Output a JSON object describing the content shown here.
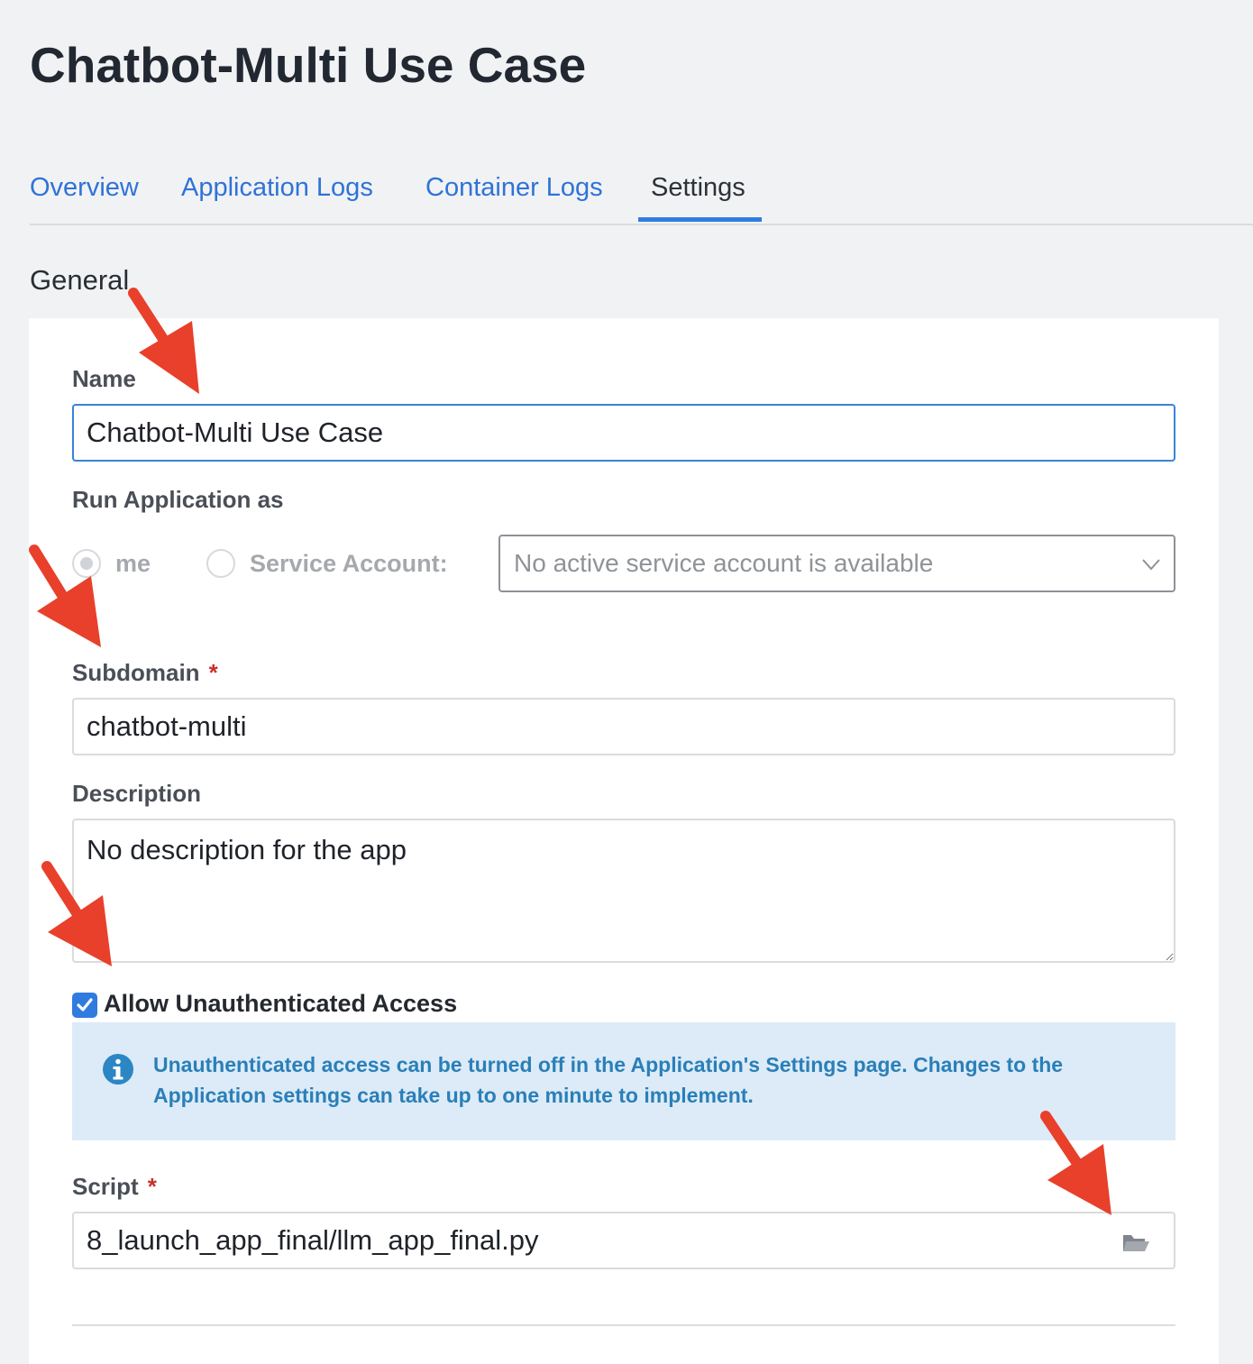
{
  "page_title": "Chatbot-Multi Use Case",
  "tabs": [
    {
      "label": "Overview",
      "active": false
    },
    {
      "label": "Application Logs",
      "active": false
    },
    {
      "label": "Container Logs",
      "active": false
    },
    {
      "label": "Settings",
      "active": true
    }
  ],
  "section": {
    "heading": "General"
  },
  "form": {
    "name": {
      "label": "Name",
      "value": "Chatbot-Multi Use Case"
    },
    "run_as": {
      "label": "Run Application as",
      "option_me": "me",
      "option_service_account": "Service Account:",
      "service_account_placeholder": "No active service account is available"
    },
    "subdomain": {
      "label": "Subdomain",
      "required_mark": "*",
      "value": "chatbot-multi"
    },
    "description": {
      "label": "Description",
      "value": "No description for the app"
    },
    "unauthenticated": {
      "label": "Allow Unauthenticated Access",
      "checked": true,
      "info_text": "Unauthenticated access can be turned off in the Application's Settings page. Changes to the Application settings can take up to one minute to implement."
    },
    "script": {
      "label": "Script",
      "required_mark": "*",
      "value": "8_launch_app_final/llm_app_final.py"
    }
  },
  "colors": {
    "accent": "#2e7de1",
    "annotation_arrow": "#e8402a",
    "info_background": "#dcebf7",
    "required": "#c9302c"
  }
}
